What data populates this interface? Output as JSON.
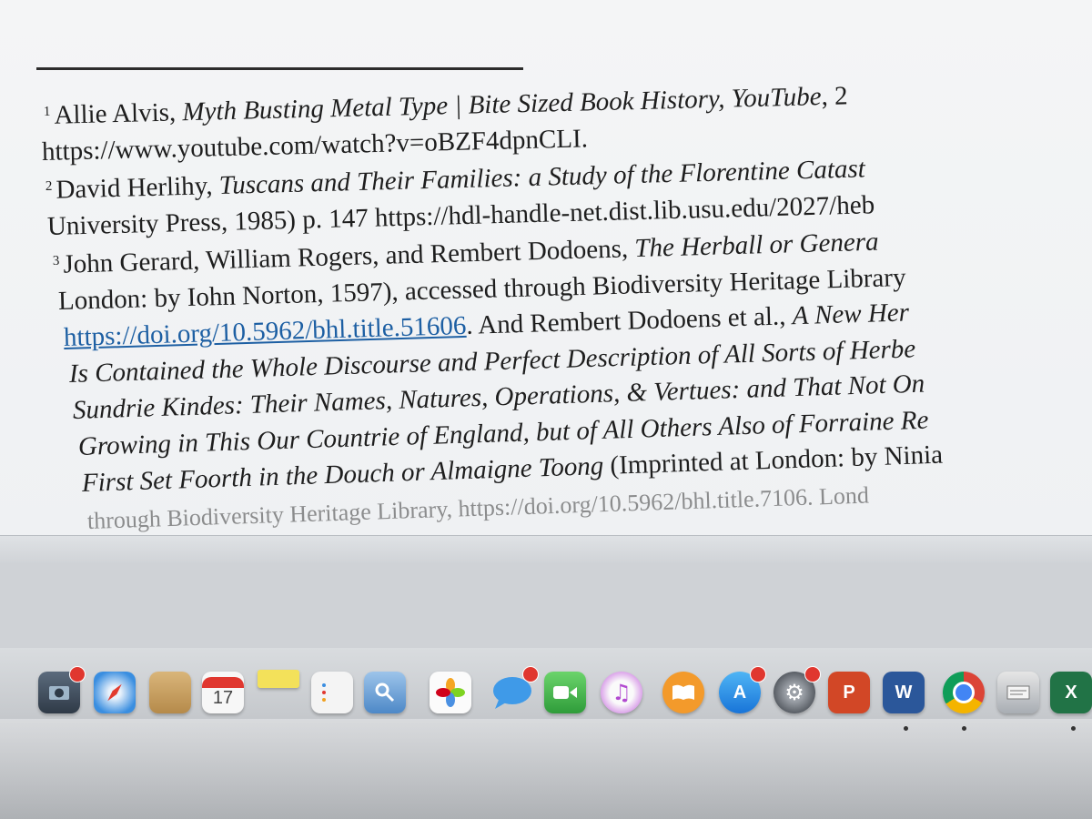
{
  "footnotes": [
    {
      "num": "1",
      "lines": [
        [
          "Allie Alvis, ",
          "Myth Busting Metal Type | Bite Sized Book History, YouTube",
          ", 2"
        ],
        [
          "https://www.youtube.com/watch?v=oBZF4dpnCLI."
        ]
      ]
    },
    {
      "num": "2",
      "lines": [
        [
          "David Herlihy, ",
          "Tuscans and Their Families: a Study of the Florentine Catast"
        ],
        [
          "University Press, 1985) p. 147  https://hdl-handle-net.dist.lib.usu.edu/2027/heb"
        ]
      ]
    },
    {
      "num": "3",
      "lines": [
        [
          "John Gerard, William Rogers, and Rembert Dodoens, ",
          "The Herball or Genera"
        ],
        [
          "London: by Iohn Norton, 1597), accessed through Biodiversity Heritage Library"
        ],
        [
          "https://doi.org/10.5962/bhl.title.51606",
          ". And Rembert Dodoens et al., ",
          "A New Her"
        ],
        [
          "Is Contained the Whole Discourse and Perfect Description of All Sorts of Herbe"
        ],
        [
          "Sundrie Kindes: Their Names, Natures, Operations, & Vertues: and That Not On"
        ],
        [
          "Growing in This Our Countrie of England, but of All Others Also of Forraine Re"
        ],
        [
          "First Set Foorth in the Douch or Almaigne Toong",
          " (Imprinted at London: by Ninia"
        ],
        [
          "through Biodiversity Heritage Library, https://doi.org/10.5962/bhl.title.7106. Lond"
        ]
      ]
    }
  ],
  "dock": {
    "calendar_day": "17",
    "icons": [
      "photo-booth-icon",
      "safari-icon",
      "notes-folder-icon",
      "calendar-icon",
      "stickies-icon",
      "reminders-icon",
      "preview-icon",
      "photos-icon",
      "messages-icon",
      "facetime-icon",
      "itunes-icon",
      "ibooks-icon",
      "app-store-icon",
      "system-prefs-icon",
      "powerpoint-icon",
      "word-icon",
      "chrome-icon",
      "script-icon",
      "excel-icon"
    ],
    "word_label": "W",
    "powerpoint_label": "P",
    "excel_label": "X"
  },
  "colors": {
    "link": "#1d5fa3",
    "page_bg": "#f2f3f5",
    "dock_bg": "#c3c6ca"
  }
}
